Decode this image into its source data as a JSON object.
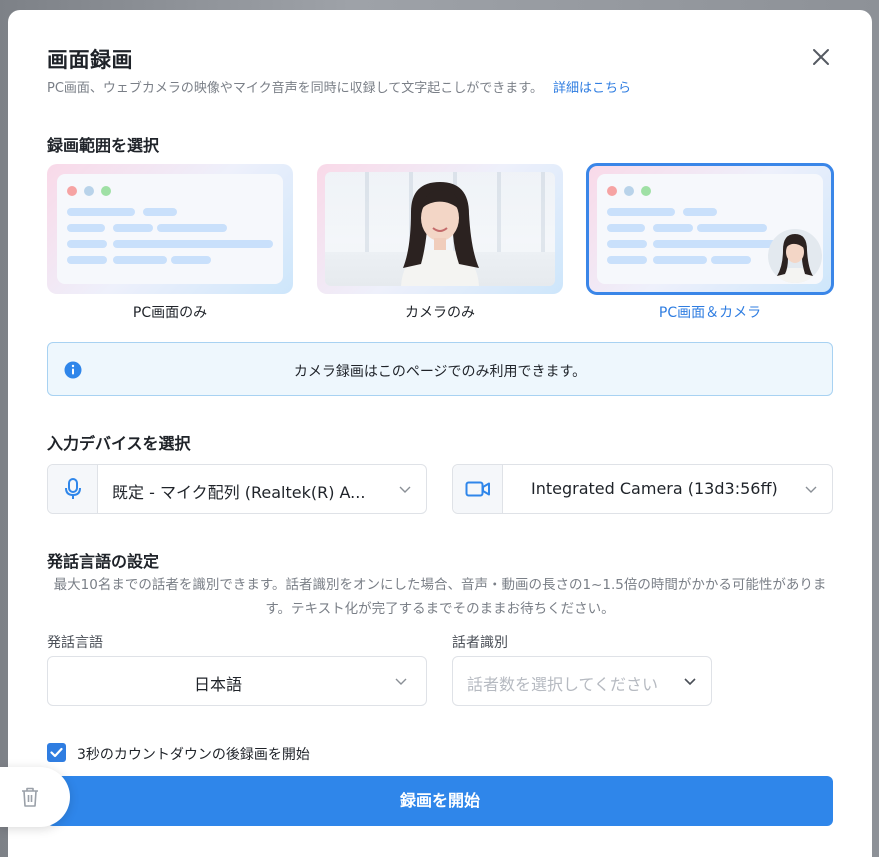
{
  "modal": {
    "title": "画面録画",
    "subtitle": "PC画面、ウェブカメラの映像やマイク音声を同時に収録して文字起こしができます。",
    "details_link": "詳細はこちら"
  },
  "scope": {
    "section_title": "録画範囲を選択",
    "options": [
      {
        "label": "PC画面のみ",
        "selected": false
      },
      {
        "label": "カメラのみ",
        "selected": false
      },
      {
        "label": "PC画面＆カメラ",
        "selected": true
      }
    ]
  },
  "info_banner": {
    "text": "カメラ録画はこのページでのみ利用できます。"
  },
  "devices": {
    "section_title": "入力デバイスを選択",
    "microphone": "既定 - マイク配列 (Realtek(R) A...",
    "camera": "Integrated Camera (13d3:56ff)"
  },
  "language": {
    "section_title": "発話言語の設定",
    "description": "最大10名までの話者を識別できます。話者識別をオンにした場合、音声・動画の長さの1~1.5倍の時間がかかる可能性があります。テキスト化が完了するまでそのままお待ちください。",
    "lang_label": "発話言語",
    "lang_value": "日本語",
    "speaker_label": "話者識別",
    "speaker_placeholder": "話者数を選択してください"
  },
  "countdown": {
    "label": "3秒のカウントダウンの後録画を開始",
    "checked": true
  },
  "start_button": "録画を開始",
  "colors": {
    "accent": "#2f86ea",
    "link": "#2f7de1",
    "info_bg": "#eef7fd"
  }
}
